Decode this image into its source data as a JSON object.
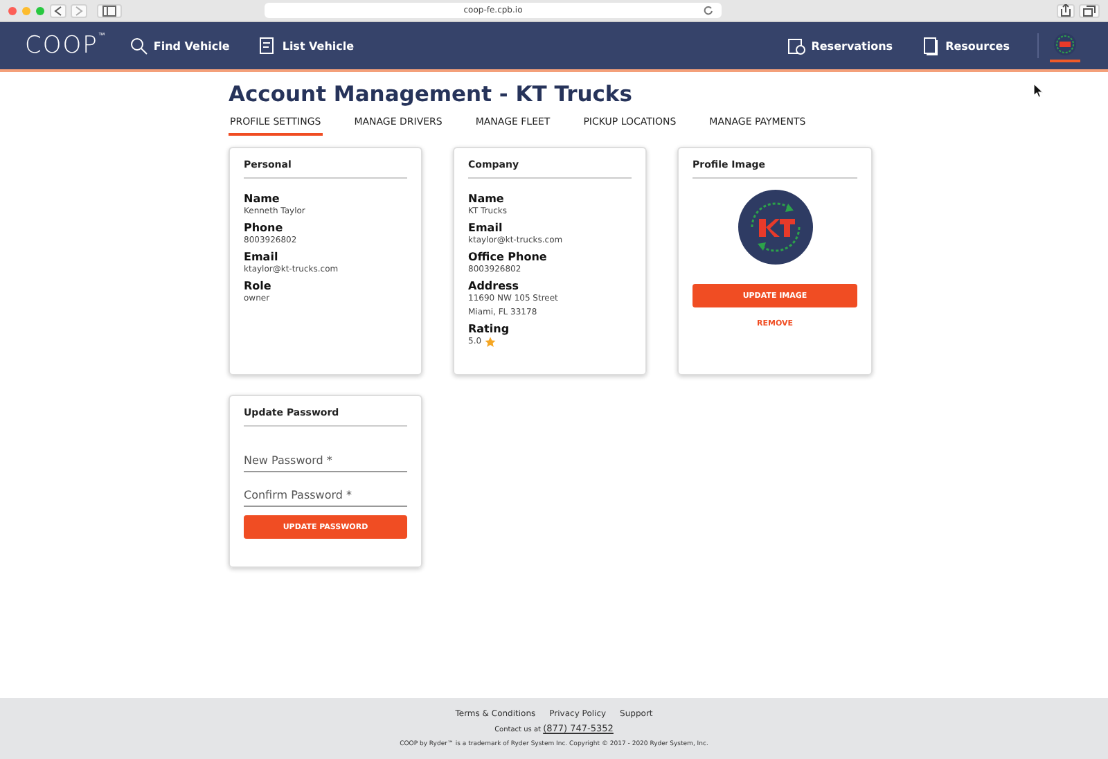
{
  "browser": {
    "url": "coop-fe.cpb.io"
  },
  "nav": {
    "logo": "COOP$^{™}$",
    "left_links": [
      {
        "label": "Find Vehicle"
      },
      {
        "label": "List Vehicle"
      }
    ],
    "right_links": [
      {
        "label": "Reservations"
      },
      {
        "label": "Resources"
      }
    ]
  },
  "page": {
    "title": "Account Management - KT Trucks",
    "tabs": [
      {
        "label": "PROFILE SETTINGS",
        "selected": true
      },
      {
        "label": "MANAGE DRIVERS",
        "selected": false
      },
      {
        "label": "MANAGE FLEET",
        "selected": false
      },
      {
        "label": "PICKUP LOCATIONS",
        "selected": false
      },
      {
        "label": "MANAGE PAYMENTS",
        "selected": false
      }
    ]
  },
  "personal": {
    "heading": "Personal",
    "fields": [
      {
        "label": "Name",
        "lines": [
          "Kenneth Taylor"
        ]
      },
      {
        "label": "Phone",
        "lines": [
          "8003926802"
        ]
      },
      {
        "label": "Email",
        "lines": [
          "ktaylor@kt-trucks.com"
        ]
      },
      {
        "label": "Role",
        "lines": [
          "owner"
        ]
      }
    ]
  },
  "company": {
    "heading": "Company",
    "fields": [
      {
        "label": "Name",
        "lines": [
          "KT Trucks"
        ]
      },
      {
        "label": "Email",
        "lines": [
          "ktaylor@kt-trucks.com"
        ]
      },
      {
        "label": "Office Phone",
        "lines": [
          "8003926802"
        ]
      },
      {
        "label": "Address",
        "lines": [
          "11690 NW 105 Street",
          "Miami, FL 33178"
        ]
      }
    ],
    "rating": {
      "label": "Rating",
      "value": "5.0"
    }
  },
  "profile_image": {
    "heading": "Profile Image",
    "update_button": "UPDATE IMAGE",
    "remove_link": "REMOVE"
  },
  "update_password": {
    "heading": "Update Password",
    "inputs": [
      {
        "placeholder": "New Password *"
      },
      {
        "placeholder": "Confirm Password *"
      }
    ],
    "button": "UPDATE PASSWORD"
  },
  "footer": {
    "links": [
      "Terms & Conditions",
      "Privacy Policy",
      "Support"
    ],
    "contact_label": "Contact us at",
    "phone": "(877) 747-5352",
    "copyright": "COOP by Ryder™ is a trademark of Ryder System Inc. Copyright © 2017 - 2020 Ryder System, Inc."
  }
}
